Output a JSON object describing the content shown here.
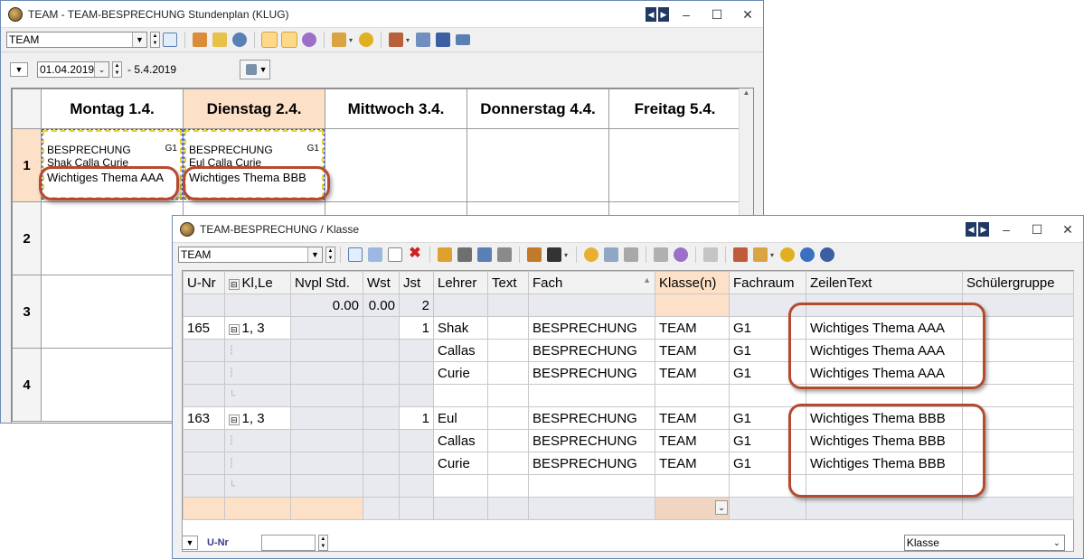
{
  "timetable_window": {
    "title": "TEAM - TEAM-BESPRECHUNG  Stundenplan  (KLUG)",
    "selector_value": "TEAM",
    "date_from": "01.04.2019",
    "date_to": "- 5.4.2019",
    "days": [
      "Montag 1.4.",
      "Dienstag 2.4.",
      "Mittwoch 3.4.",
      "Donnerstag 4.4.",
      "Freitag 5.4."
    ],
    "periods": [
      "1",
      "2",
      "3",
      "4"
    ],
    "lessons": [
      {
        "subject": "BESPRECHUNG",
        "room": "G1",
        "teachers": "Shak   Calla  Curie",
        "text": "Wichtiges Thema AAA"
      },
      {
        "subject": "BESPRECHUNG",
        "room": "G1",
        "teachers": "Eul      Calla  Curie",
        "text": "Wichtiges Thema BBB"
      }
    ]
  },
  "class_window": {
    "title": "TEAM-BESPRECHUNG / Klasse",
    "selector_value": "TEAM",
    "columns": [
      "U-Nr",
      "Kl,Le",
      "Nvpl Std.",
      "Wst",
      "Jst",
      "Lehrer",
      "Text",
      "Fach",
      "Klasse(n)",
      "Fachraum",
      "ZeilenText",
      "Schülergruppe"
    ],
    "totals": {
      "nvpl": "0.00",
      "wst": "0.00",
      "jst": "2"
    },
    "groups": [
      {
        "unr": "165",
        "klle": "1, 3",
        "jst": "1",
        "rows": [
          {
            "lehrer": "Shak",
            "fach": "BESPRECHUNG",
            "klasse": "TEAM",
            "raum": "G1",
            "zeilentext": "Wichtiges Thema AAA"
          },
          {
            "lehrer": "Callas",
            "fach": "BESPRECHUNG",
            "klasse": "TEAM",
            "raum": "G1",
            "zeilentext": "Wichtiges Thema AAA"
          },
          {
            "lehrer": "Curie",
            "fach": "BESPRECHUNG",
            "klasse": "TEAM",
            "raum": "G1",
            "zeilentext": "Wichtiges Thema AAA"
          }
        ]
      },
      {
        "unr": "163",
        "klle": "1, 3",
        "jst": "1",
        "rows": [
          {
            "lehrer": "Eul",
            "fach": "BESPRECHUNG",
            "klasse": "TEAM",
            "raum": "G1",
            "zeilentext": "Wichtiges Thema BBB"
          },
          {
            "lehrer": "Callas",
            "fach": "BESPRECHUNG",
            "klasse": "TEAM",
            "raum": "G1",
            "zeilentext": "Wichtiges Thema BBB"
          },
          {
            "lehrer": "Curie",
            "fach": "BESPRECHUNG",
            "klasse": "TEAM",
            "raum": "G1",
            "zeilentext": "Wichtiges Thema BBB"
          }
        ]
      }
    ],
    "footer": {
      "unr_label": "U-Nr",
      "view_select": "Klasse"
    }
  },
  "colors": {
    "accent_highlight": "#fde0c8",
    "annotation": "#b54a2f",
    "window_border": "#6d8bb5"
  }
}
